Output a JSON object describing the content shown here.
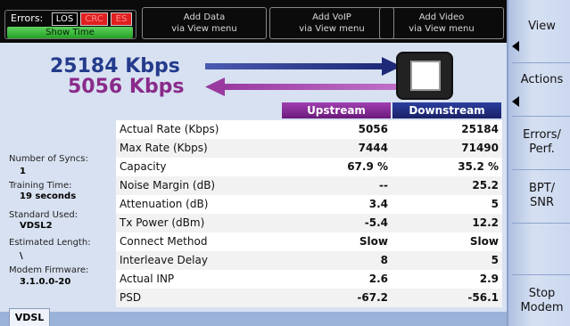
{
  "topbar": {
    "errors_label": "Errors:",
    "badges": [
      "LOS",
      "CRC",
      "ES"
    ],
    "show_time": "Show Time",
    "buttons": [
      {
        "title": "Add Data",
        "subtitle": "via View menu"
      },
      {
        "title": "Add VoIP",
        "subtitle": "via View menu"
      },
      {
        "title": "Add Video",
        "subtitle": "via View menu"
      }
    ]
  },
  "rates": {
    "upstream": "25184 Kbps",
    "downstream": "5056 Kbps"
  },
  "info": {
    "syncs_label": "Number of Syncs:",
    "syncs_value": "1",
    "training_label": "Training Time:",
    "training_value": "19 seconds",
    "standard_label": "Standard Used:",
    "standard_value": "VDSL2",
    "length_label": "Estimated Length:",
    "length_value": "\\",
    "firmware_label": "Modem Firmware:",
    "firmware_value": "3.1.0.0-20"
  },
  "table": {
    "header_up": "Upstream",
    "header_down": "Downstream",
    "rows": [
      {
        "label": "Actual Rate (Kbps)",
        "up": "5056",
        "down": "25184"
      },
      {
        "label": "Max Rate (Kbps)",
        "up": "7444",
        "down": "71490"
      },
      {
        "label": "Capacity",
        "up": "67.9 %",
        "down": "35.2 %"
      },
      {
        "label": "Noise Margin (dB)",
        "up": "--",
        "down": "25.2"
      },
      {
        "label": "Attenuation (dB)",
        "up": "3.4",
        "down": "5"
      },
      {
        "label": "Tx Power (dBm)",
        "up": "-5.4",
        "down": "12.2"
      },
      {
        "label": "Connect Method",
        "up": "Slow",
        "down": "Slow"
      },
      {
        "label": "Interleave Delay",
        "up": "8",
        "down": "5"
      },
      {
        "label": "Actual INP",
        "up": "2.6",
        "down": "2.9"
      },
      {
        "label": "PSD",
        "up": "-67.2",
        "down": "-56.1"
      }
    ]
  },
  "tab": "VDSL",
  "sidebar": {
    "view": "View",
    "actions": "Actions",
    "errors_perf_1": "Errors/",
    "errors_perf_2": "Perf.",
    "bpt_1": "BPT/",
    "bpt_2": "SNR",
    "stop_1": "Stop",
    "stop_2": "Modem"
  },
  "colors": {
    "upstream": "#243b8c",
    "downstream": "#8a2a8a",
    "show_time": "#24a024",
    "error": "#e02020"
  }
}
